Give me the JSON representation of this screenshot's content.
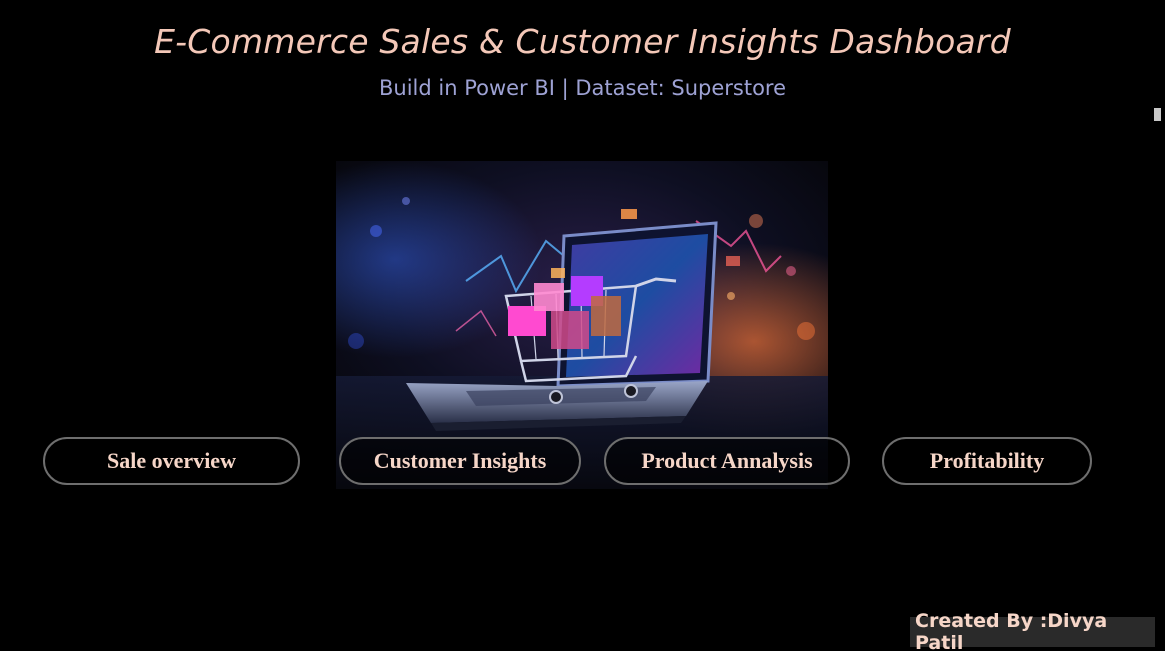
{
  "header": {
    "title": "E-Commerce Sales & Customer Insights Dashboard",
    "subtitle": "Build in Power BI | Dataset: Superstore"
  },
  "navigation": {
    "buttons": [
      {
        "label": "Sale overview"
      },
      {
        "label": "Customer Insights"
      },
      {
        "label": "Product Annalysis"
      },
      {
        "label": "Profitability"
      }
    ]
  },
  "footer": {
    "credit": "Created By :Divya Patil"
  },
  "colors": {
    "background": "#000000",
    "title": "#f4c8b8",
    "subtitle": "#9ea2d4",
    "button_text": "#f6d6c8",
    "button_border": "#6e6e6e",
    "credit_bg": "#2a2a2a"
  }
}
